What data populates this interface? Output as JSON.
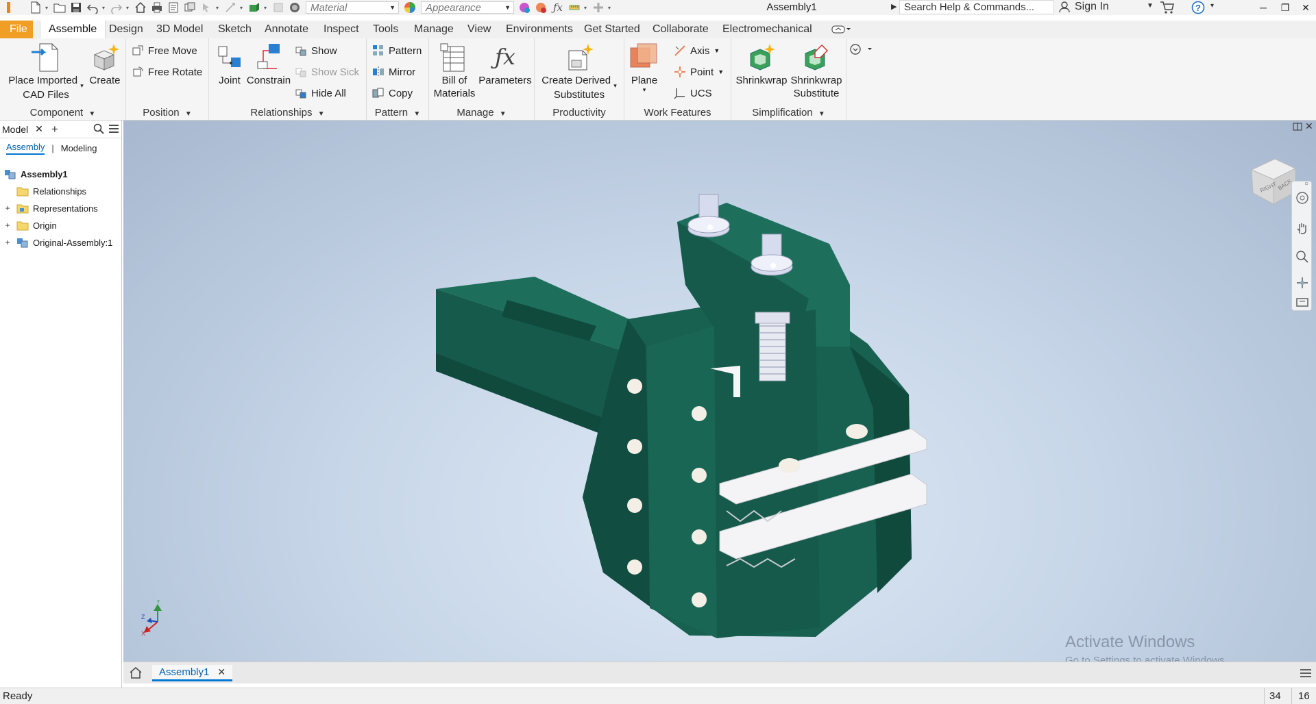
{
  "app": {
    "title": "Assembly1",
    "colors": {
      "file_tab": "#f09e24",
      "accent": "#0078d4",
      "model": "#17594a"
    }
  },
  "titlebar": {
    "material_placeholder": "Material",
    "appearance_placeholder": "Appearance",
    "search_placeholder": "Search Help & Commands...",
    "sign_in": "Sign In"
  },
  "tabs": [
    "File",
    "Assemble",
    "Design",
    "3D Model",
    "Sketch",
    "Annotate",
    "Inspect",
    "Tools",
    "Manage",
    "View",
    "Environments",
    "Get Started",
    "Collaborate",
    "Electromechanical"
  ],
  "ribbon": {
    "component": {
      "title": "Component",
      "place_imported_1": "Place Imported",
      "place_imported_2": "CAD Files",
      "create": "Create"
    },
    "position": {
      "title": "Position",
      "free_move": "Free Move",
      "free_rotate": "Free Rotate"
    },
    "relationships": {
      "title": "Relationships",
      "joint": "Joint",
      "constrain": "Constrain",
      "show": "Show",
      "show_sick": "Show Sick",
      "hide_all": "Hide All"
    },
    "pattern": {
      "title": "Pattern",
      "pattern": "Pattern",
      "mirror": "Mirror",
      "copy": "Copy"
    },
    "manage": {
      "title": "Manage",
      "bom_1": "Bill of",
      "bom_2": "Materials",
      "parameters": "Parameters"
    },
    "productivity": {
      "title": "Productivity",
      "derived_1": "Create Derived",
      "derived_2": "Substitutes"
    },
    "work_features": {
      "title": "Work Features",
      "plane": "Plane",
      "axis": "Axis",
      "point": "Point",
      "ucs": "UCS"
    },
    "simplification": {
      "title": "Simplification",
      "shrinkwrap": "Shrinkwrap",
      "shrinkwrap_sub_1": "Shrinkwrap",
      "shrinkwrap_sub_2": "Substitute"
    }
  },
  "browser": {
    "tab_label": "Model",
    "sub_assembly": "Assembly",
    "sub_modeling": "Modeling",
    "tree": [
      {
        "label": "Assembly1",
        "icon": "assembly-icon"
      },
      {
        "label": "Relationships",
        "icon": "folder-icon"
      },
      {
        "label": "Representations",
        "icon": "representations-icon"
      },
      {
        "label": "Origin",
        "icon": "folder-icon"
      },
      {
        "label": "Original-Assembly:1",
        "icon": "assembly-icon"
      }
    ]
  },
  "viewcube": {
    "face_right": "RIGHT",
    "face_back": "BACK"
  },
  "triad": {
    "x": "X",
    "y": "Y",
    "z": "Z"
  },
  "watermark": {
    "line1": "Activate Windows",
    "line2": "Go to Settings to activate Windows."
  },
  "document_tab": {
    "label": "Assembly1"
  },
  "status": {
    "text": "Ready",
    "count_a": "34",
    "count_b": "16"
  }
}
